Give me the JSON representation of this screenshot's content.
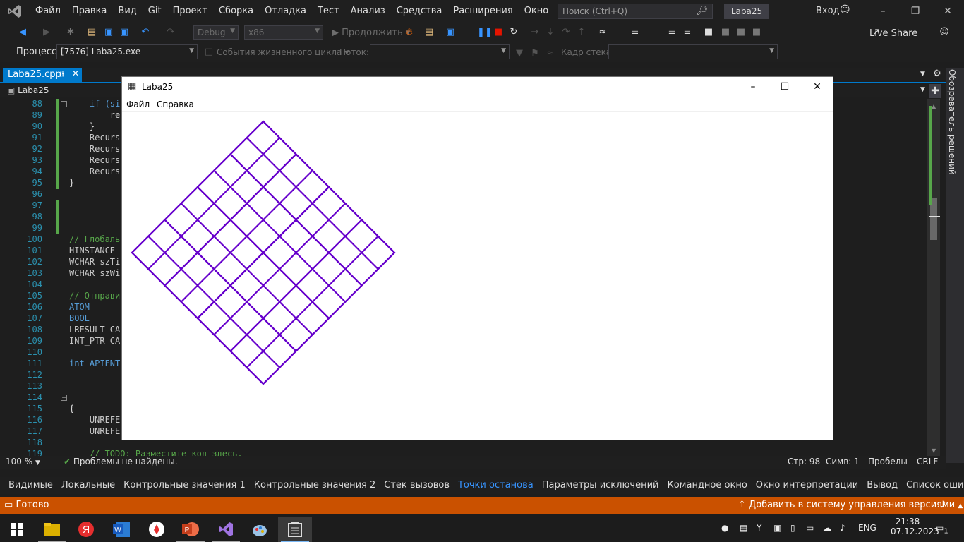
{
  "menubar": {
    "items": [
      "Файл",
      "Правка",
      "Вид",
      "Git",
      "Проект",
      "Сборка",
      "Отладка",
      "Тест",
      "Анализ",
      "Средства",
      "Расширения",
      "Окно",
      "Справка"
    ],
    "search_placeholder": "Поиск (Ctrl+Q)",
    "solution_name": "Laba25",
    "login_label": "Вход"
  },
  "toolbar": {
    "config": "Debug",
    "platform": "x86",
    "continue_label": "Продолжить",
    "liveshare_label": "Live Share"
  },
  "process_bar": {
    "process_label": "Процесс:",
    "process_value": "[7576] Laba25.exe",
    "lifecycle_label": "События жизненного цикла",
    "thread_label": "Поток:",
    "stack_frame_label": "Кадр стека:"
  },
  "editor": {
    "tab_name": "Laba25.cpp",
    "scope": "Laba25",
    "lines": [
      {
        "n": "88",
        "code": "    if (si"
      },
      {
        "n": "89",
        "code": "        ret"
      },
      {
        "n": "90",
        "code": "    }"
      },
      {
        "n": "91",
        "code": "    Recursi"
      },
      {
        "n": "92",
        "code": "    Recursi"
      },
      {
        "n": "93",
        "code": "    Recursi"
      },
      {
        "n": "94",
        "code": "    Recursi"
      },
      {
        "n": "95",
        "code": "}"
      },
      {
        "n": "96",
        "code": ""
      },
      {
        "n": "97",
        "code": ""
      },
      {
        "n": "98",
        "code": ""
      },
      {
        "n": "99",
        "code": ""
      },
      {
        "n": "100",
        "code": "// Глобальн"
      },
      {
        "n": "101",
        "code": "HINSTANCE h"
      },
      {
        "n": "102",
        "code": "WCHAR szTit"
      },
      {
        "n": "103",
        "code": "WCHAR szWin"
      },
      {
        "n": "104",
        "code": ""
      },
      {
        "n": "105",
        "code": "// Отправит"
      },
      {
        "n": "106",
        "code": "ATOM"
      },
      {
        "n": "107",
        "code": "BOOL"
      },
      {
        "n": "108",
        "code": "LRESULT CAL"
      },
      {
        "n": "109",
        "code": "INT_PTR CAL"
      },
      {
        "n": "110",
        "code": ""
      },
      {
        "n": "111",
        "code": "int APIENTR"
      },
      {
        "n": "112",
        "code": ""
      },
      {
        "n": "113",
        "code": ""
      },
      {
        "n": "114",
        "code": ""
      },
      {
        "n": "115",
        "code": "{"
      },
      {
        "n": "116",
        "code": "    UNREFER"
      },
      {
        "n": "117",
        "code": "    UNREFER"
      },
      {
        "n": "118",
        "code": ""
      },
      {
        "n": "119",
        "code": "    // TODO: Разместите код здесь."
      }
    ]
  },
  "status_line": {
    "zoom": "100 %",
    "problems": "Проблемы не найдены.",
    "line": "Стр: 98",
    "col": "Симв: 1",
    "indent": "Пробелы",
    "eol": "CRLF"
  },
  "side_panel": {
    "label": "Обозреватель решений"
  },
  "bottom_tabs": [
    "Видимые",
    "Локальные",
    "Контрольные значения 1",
    "Контрольные значения 2",
    "Стек вызовов",
    "Точки останова",
    "Параметры исключений",
    "Командное окно",
    "Окно интерпретации",
    "Вывод",
    "Список ошибок"
  ],
  "statusbar": {
    "ready": "Готово",
    "vcs": "Добавить в систему управления версиями"
  },
  "app_window": {
    "title": "Laba25",
    "menu": [
      "Файл",
      "Справка"
    ],
    "drawing_color": "#6600cc",
    "fractal_depth": 3
  },
  "taskbar": {
    "lang": "ENG",
    "time": "21:38",
    "date": "07.12.2023",
    "notifications": "1"
  },
  "colors": {
    "accent": "#007acc",
    "status": "#ca5100",
    "line_numbers": "#2b91af",
    "comment": "#57a64a"
  }
}
